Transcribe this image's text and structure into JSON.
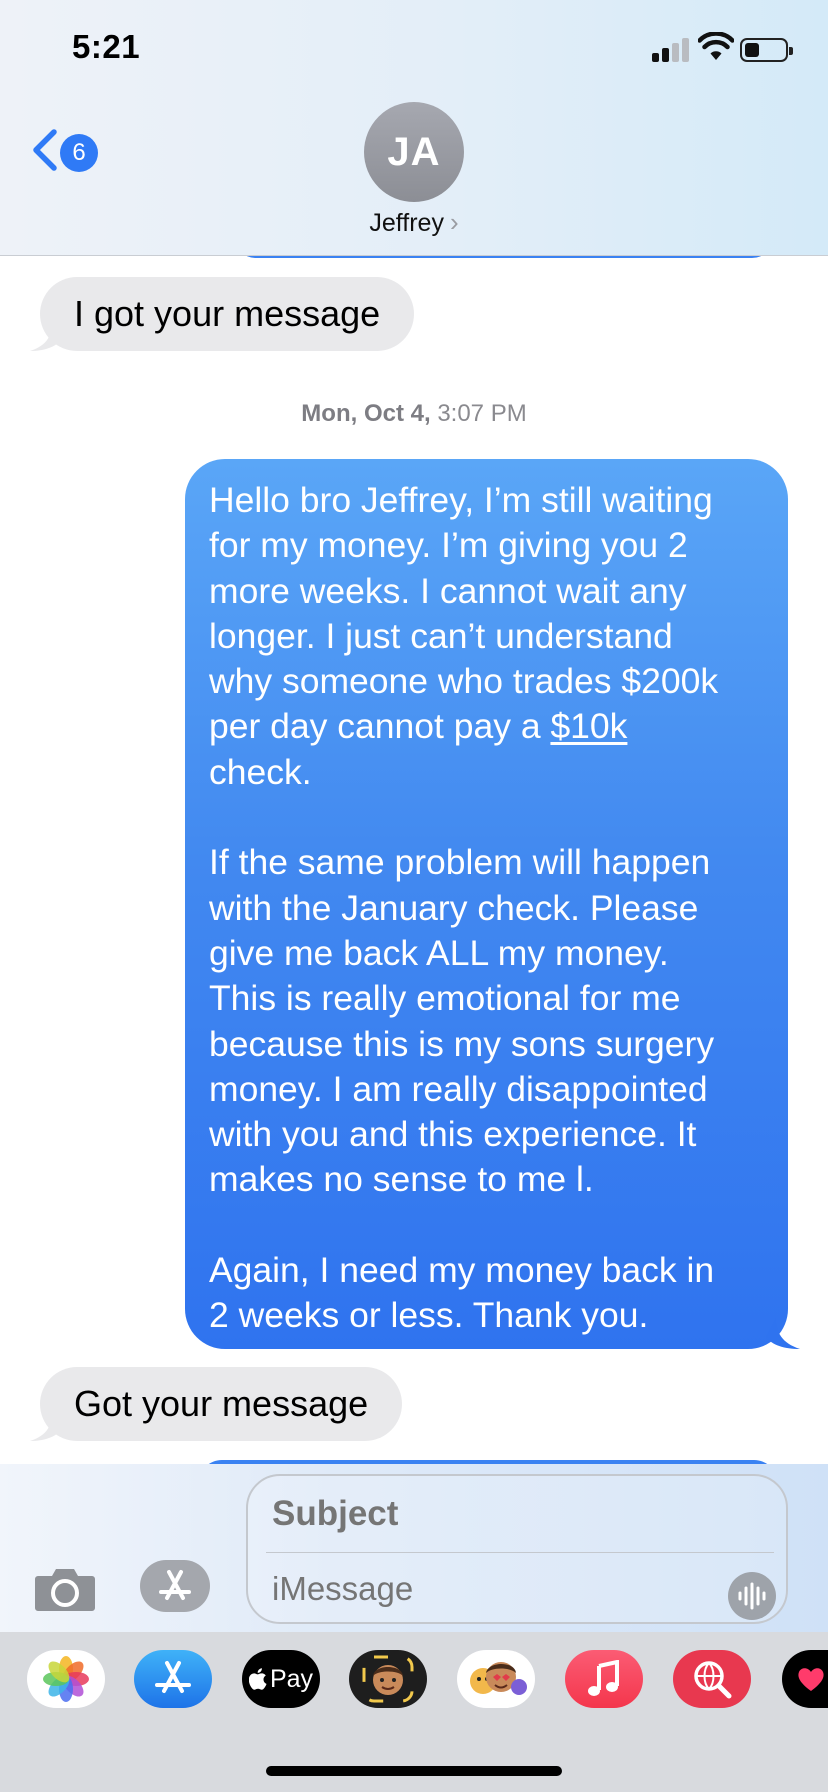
{
  "status_bar": {
    "time": "5:21",
    "signal_bars": 2,
    "battery_level": 0.25
  },
  "header": {
    "back_badge_count": "6",
    "avatar_initials": "JA",
    "contact_name": "Jeffrey",
    "contact_chevron": "›"
  },
  "conversation": {
    "incoming_1": "I got your message",
    "timestamp_day": "Mon, Oct 4,",
    "timestamp_time": "3:07 PM",
    "outgoing": {
      "para1_before_link": "Hello bro Jeffrey, I’m still waiting\nfor my money. I’m giving you 2\nmore weeks. I cannot wait any\nlonger. I just can’t understand\nwhy someone who trades $200k\nper day cannot pay a ",
      "para1_link": "$10k",
      "para1_after_link": "\ncheck.",
      "para2": "If the same problem will happen\nwith the January check. Please\ngive me back ALL my money.\nThis is really emotional for me\nbecause this is my sons surgery\nmoney. I am really disappointed\nwith you and this experience. It\nmakes no sense to me l.",
      "para3": "Again, I need my money back in\n2 weeks or less. Thank you."
    },
    "incoming_2": "Got your message"
  },
  "compose": {
    "subject_placeholder": "Subject",
    "message_placeholder": "iMessage"
  },
  "app_drawer": {
    "apple_pay_label": "Pay",
    "apps": [
      "photos-app",
      "app-store-app",
      "apple-pay-app",
      "memoji-camera-app",
      "memoji-stickers-app",
      "music-app",
      "web-images-search-app",
      "digital-touch-app"
    ]
  },
  "colors": {
    "imessage_blue": "#3a82f2",
    "incoming_gray": "#e9e9eb",
    "badge_blue": "#2f7af6"
  }
}
